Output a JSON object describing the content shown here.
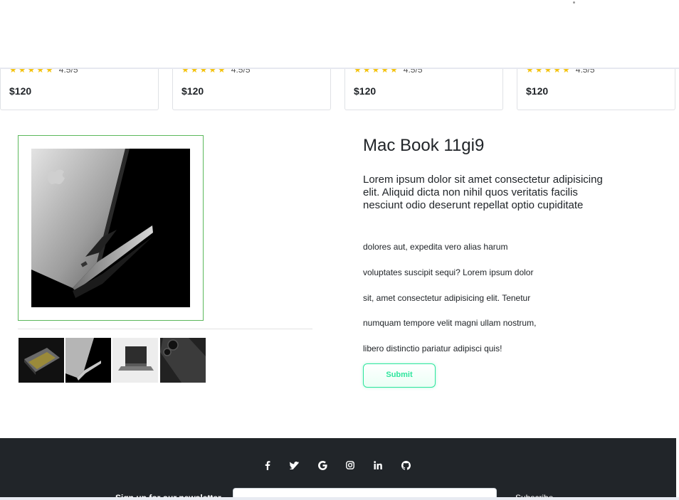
{
  "products": [
    {
      "stars": "★★★★★",
      "rating": "4.5/5",
      "price": "$120"
    },
    {
      "stars": "★★★★★",
      "rating": "4.5/5",
      "price": "$120"
    },
    {
      "stars": "★★★★★",
      "rating": "4.5/5",
      "price": "$120"
    },
    {
      "stars": "★★★★★",
      "rating": "4.5/5",
      "price": "$120"
    }
  ],
  "product": {
    "title": "Mac Book 11gi9",
    "lead": "Lorem ipsum dolor sit amet consectetur adipisicing elit. Aliquid dicta non nihil quos veritatis facilis nesciunt odio deserunt repellat optio cupiditate",
    "description_lines": [
      "dolores aut, expedita vero alias harum",
      "voluptates suscipit sequi? Lorem ipsum dolor",
      "sit, amet consectetur adipisicing elit. Tenetur",
      "numquam tempore velit magni ullam nostrum,",
      "libero distinctio pariatur adipisci quis!"
    ],
    "submit_label": "Submit"
  },
  "gallery": {
    "thumbnails": [
      "laptop-angled-dark",
      "laptop-side-dark",
      "laptop-open-light",
      "phone-camera-dark"
    ]
  },
  "footer": {
    "social_icons": [
      "facebook-icon",
      "twitter-icon",
      "google-icon",
      "instagram-icon",
      "linkedin-icon",
      "github-icon"
    ],
    "newsletter_label": "Sign up for our newsletter",
    "subscribe_label": "Subscribe",
    "email_placeholder": ""
  },
  "colors": {
    "accent": "#2ee59d",
    "frame": "#5cb85c",
    "footer_bg": "#212529",
    "star": "#f4c20d"
  }
}
